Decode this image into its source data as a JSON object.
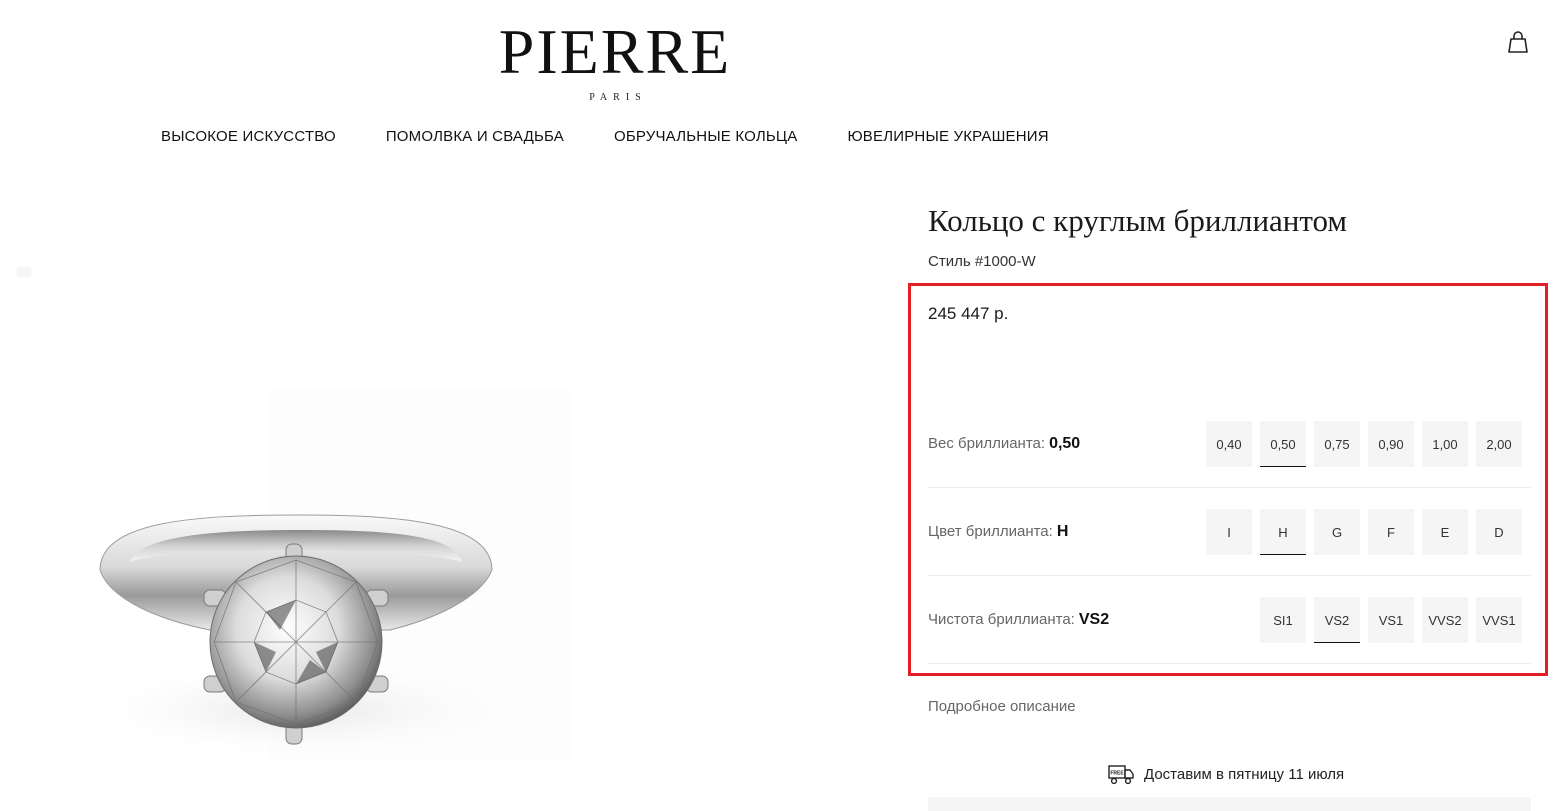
{
  "header": {
    "logo_main": "PIERRE",
    "logo_sub": "PARIS",
    "cart_icon": "shopping-bag-icon"
  },
  "nav": {
    "items": [
      {
        "label": "ВЫСОКОЕ ИСКУССТВО"
      },
      {
        "label": "ПОМОЛВКА И СВАДЬБА"
      },
      {
        "label": "ОБРУЧАЛЬНЫЕ КОЛЬЦА"
      },
      {
        "label": "ЮВЕЛИРНЫЕ УКРАШЕНИЯ"
      }
    ]
  },
  "product": {
    "title": "Кольцо с круглым бриллиантом",
    "style_code": "Стиль #1000-W",
    "price": "245 447 р.",
    "image_icon": "diamond-ring-image"
  },
  "options": {
    "carat": {
      "label": "Вес бриллианта:",
      "selected": "0,50",
      "values": [
        "0,40",
        "0,50",
        "0,75",
        "0,90",
        "1,00",
        "2,00"
      ]
    },
    "color": {
      "label": "Цвет бриллианта:",
      "selected": "H",
      "values": [
        "I",
        "H",
        "G",
        "F",
        "E",
        "D"
      ]
    },
    "clarity": {
      "label": "Чистота бриллианта:",
      "selected": "VS2",
      "values": [
        "SI1",
        "VS2",
        "VS1",
        "VVS2",
        "VVS1"
      ]
    }
  },
  "details_link": "Подробное описание",
  "delivery": {
    "text": "Доставим в пятницу 11 июля",
    "icon": "free-delivery-truck-icon",
    "icon_badge": "FREE"
  },
  "colors": {
    "highlight": "#e41e25",
    "chip_bg": "#f5f5f5"
  }
}
